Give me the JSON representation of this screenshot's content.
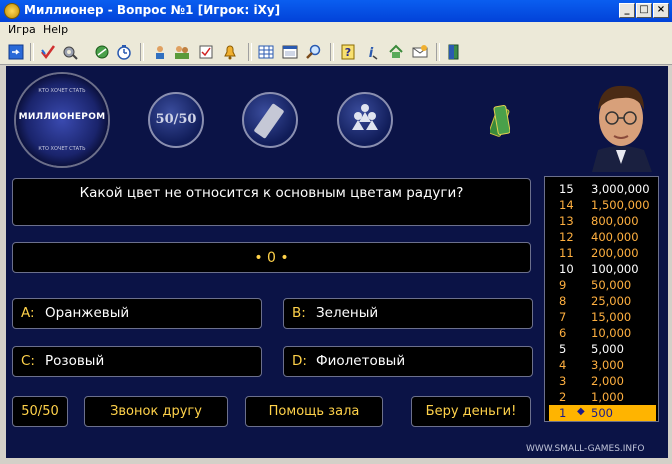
{
  "window": {
    "title": "Миллионер - Вопрос №1 [Игрок: iXy]",
    "minimize": "_",
    "maximize": "□",
    "close": "×"
  },
  "menu": [
    "Игра",
    "Help"
  ],
  "logo": {
    "text": "МИЛЛИОНЕРОМ",
    "ring_top": "КТО ХОЧЕТ СТАТЬ",
    "ring_bottom": "КТО ХОЧЕТ СТАТЬ"
  },
  "lifelines": {
    "fifty": "50/50"
  },
  "question": "Какой цвет не относится к основным цветам радуги?",
  "status": "• 0 •",
  "answers": [
    {
      "letter": "A:",
      "text": "Оранжевый"
    },
    {
      "letter": "B:",
      "text": "Зеленый"
    },
    {
      "letter": "C:",
      "text": "Розовый"
    },
    {
      "letter": "D:",
      "text": "Фиолетовый"
    }
  ],
  "buttons": {
    "fifty": "50/50",
    "call": "Звонок другу",
    "audience": "Помощь зала",
    "take_money": "Беру деньги!"
  },
  "ladder": [
    {
      "num": "15",
      "amount": "3,000,000"
    },
    {
      "num": "14",
      "amount": "1,500,000"
    },
    {
      "num": "13",
      "amount": "800,000"
    },
    {
      "num": "12",
      "amount": "400,000"
    },
    {
      "num": "11",
      "amount": "200,000"
    },
    {
      "num": "10",
      "amount": "100,000"
    },
    {
      "num": "9",
      "amount": "50,000"
    },
    {
      "num": "8",
      "amount": "25,000"
    },
    {
      "num": "7",
      "amount": "15,000"
    },
    {
      "num": "6",
      "amount": "10,000"
    },
    {
      "num": "5",
      "amount": "5,000"
    },
    {
      "num": "4",
      "amount": "3,000"
    },
    {
      "num": "3",
      "amount": "2,000"
    },
    {
      "num": "2",
      "amount": "1,000"
    },
    {
      "num": "1",
      "amount": "500"
    }
  ],
  "watermark": "WWW.SMALL-GAMES.INFO",
  "colors": {
    "accent": "#ffd24a",
    "current_rung": "#ffb400",
    "background": "#0b1346"
  }
}
